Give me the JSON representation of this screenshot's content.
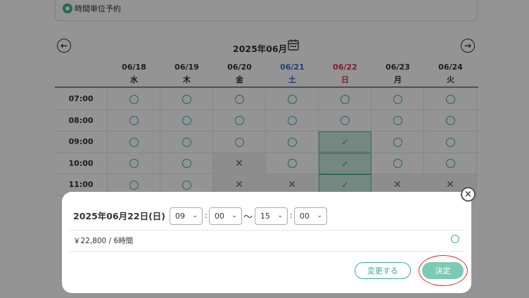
{
  "booking_type": {
    "label": "時間単位予約"
  },
  "calendar": {
    "month_title": "2025年06月",
    "days": [
      {
        "date": "06/18",
        "dow": "水",
        "kind": "weekday"
      },
      {
        "date": "06/19",
        "dow": "木",
        "kind": "weekday"
      },
      {
        "date": "06/20",
        "dow": "金",
        "kind": "weekday"
      },
      {
        "date": "06/21",
        "dow": "土",
        "kind": "saturday"
      },
      {
        "date": "06/22",
        "dow": "日",
        "kind": "sunday"
      },
      {
        "date": "06/23",
        "dow": "月",
        "kind": "weekday"
      },
      {
        "date": "06/24",
        "dow": "火",
        "kind": "weekday"
      }
    ],
    "rows": [
      {
        "time": "07:00",
        "slots": [
          "available",
          "available",
          "available",
          "available",
          "available",
          "available",
          "available"
        ]
      },
      {
        "time": "08:00",
        "slots": [
          "available",
          "available",
          "available",
          "available",
          "available",
          "available",
          "available"
        ]
      },
      {
        "time": "09:00",
        "slots": [
          "available",
          "available",
          "available",
          "available",
          "selected",
          "available",
          "available"
        ]
      },
      {
        "time": "10:00",
        "slots": [
          "available",
          "available",
          "unavailable",
          "available",
          "selected",
          "available",
          "available"
        ]
      },
      {
        "time": "11:00",
        "slots": [
          "available",
          "available",
          "unavailable",
          "unavailable",
          "selected",
          "unavailable",
          "unavailable"
        ]
      }
    ],
    "colors": {
      "accent": "#3fae95",
      "saturday": "#3a6cc8",
      "sunday": "#d0344f",
      "selected_bg": "#c9eadf"
    }
  },
  "modal": {
    "date_label": "2025年06月22日(日)",
    "start_hour": "09",
    "start_minute": "00",
    "end_hour": "15",
    "end_minute": "00",
    "colon": ":",
    "tilde": "〜",
    "price_text": "￥22,800  / 6時間",
    "change_button": "変更する",
    "decide_button": "決定",
    "close_icon": "×"
  },
  "icons": {
    "prev": "arrow-left-circle-icon",
    "next": "arrow-right-circle-icon",
    "calendar": "calendar-icon",
    "available": "circle-icon",
    "unavailable": "cross-icon",
    "selected": "check-icon"
  }
}
